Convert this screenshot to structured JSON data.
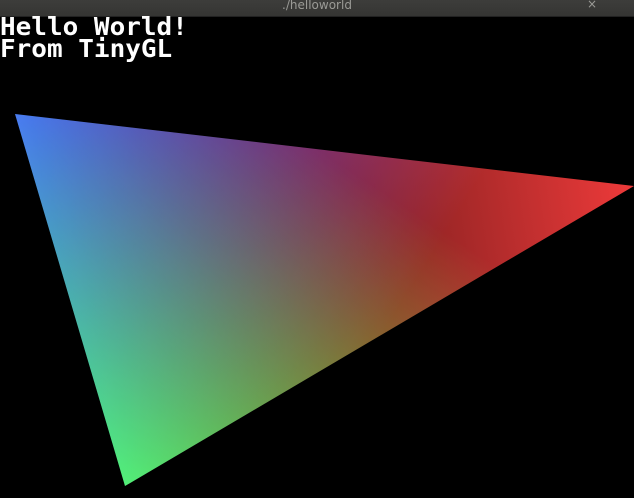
{
  "window": {
    "title": "./helloworld",
    "close_glyph": "×"
  },
  "viewport": {
    "background_color": "#000000",
    "text_lines": [
      "Hello World!",
      "From TinyGL"
    ],
    "text_color": "#ffffff",
    "triangle": {
      "vertex_colors": [
        "#3a3cf0",
        "#ee3a3a",
        "#3aee3a"
      ]
    }
  }
}
